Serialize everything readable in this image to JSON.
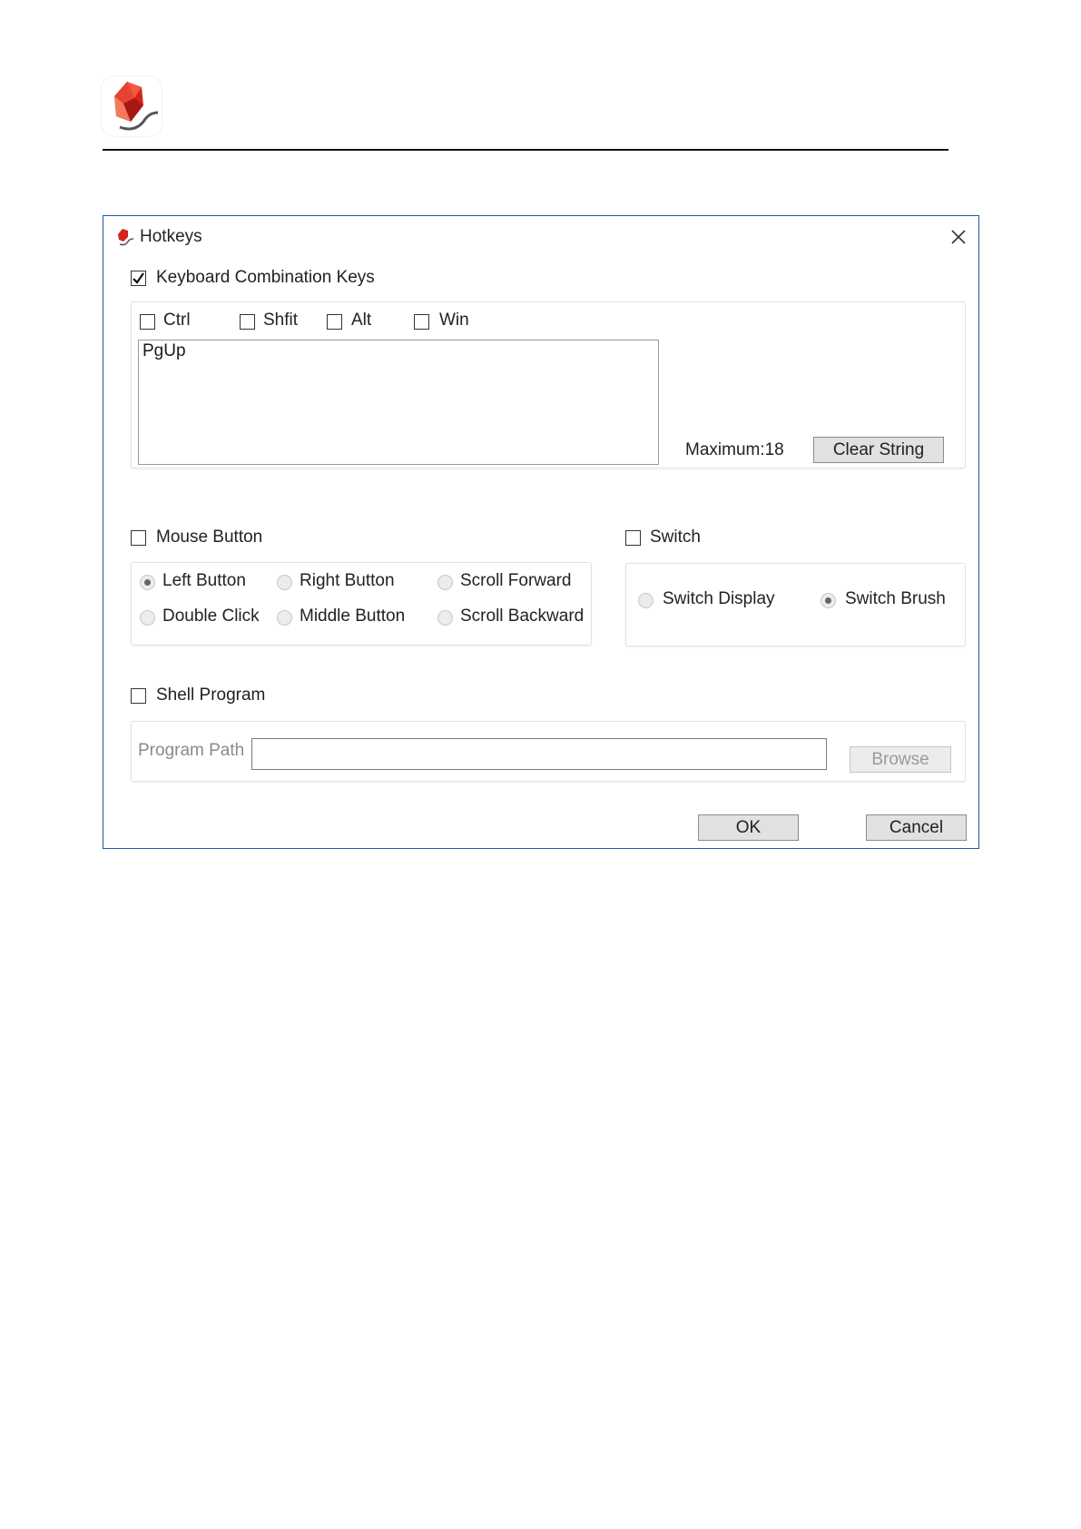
{
  "dialog": {
    "title": "Hotkeys",
    "close_icon": "close-icon"
  },
  "keyboard": {
    "label": "Keyboard Combination Keys",
    "checked": true,
    "modifiers": [
      {
        "label": "Ctrl",
        "checked": false
      },
      {
        "label": "Shfit",
        "checked": false
      },
      {
        "label": "Alt",
        "checked": false
      },
      {
        "label": "Win",
        "checked": false
      }
    ],
    "key_string": "PgUp",
    "maximum_label": "Maximum:18",
    "clear_button": "Clear String"
  },
  "mouse": {
    "label": "Mouse Button",
    "checked": false,
    "options": [
      {
        "label": "Left Button",
        "selected": true
      },
      {
        "label": "Right Button",
        "selected": false
      },
      {
        "label": "Scroll Forward",
        "selected": false
      },
      {
        "label": "Double Click",
        "selected": false
      },
      {
        "label": "Middle Button",
        "selected": false
      },
      {
        "label": "Scroll Backward",
        "selected": false
      }
    ]
  },
  "switch": {
    "label": "Switch",
    "checked": false,
    "options": [
      {
        "label": "Switch Display",
        "selected": false
      },
      {
        "label": "Switch Brush",
        "selected": true
      }
    ]
  },
  "shell": {
    "label": "Shell Program",
    "checked": false,
    "path_label": "Program Path",
    "path_value": "",
    "browse_button": "Browse"
  },
  "footer": {
    "ok_button": "OK",
    "cancel_button": "Cancel"
  }
}
